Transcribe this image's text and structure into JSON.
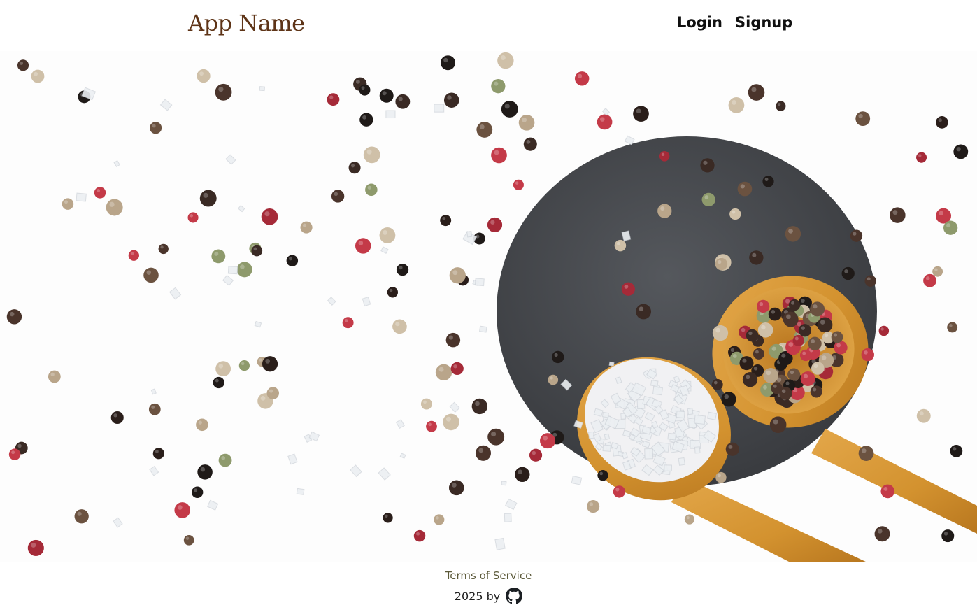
{
  "header": {
    "app_name": "App Name",
    "nav": {
      "login_label": "Login",
      "signup_label": "Signup"
    }
  },
  "hero": {
    "image_icon": "spices-on-slate-photo"
  },
  "footer": {
    "terms_label": "Terms of Service",
    "credit_text": "2025 by",
    "credit_icon": "github-icon"
  },
  "colors": {
    "logo": "#5e3417",
    "nav_text": "#111111",
    "footer_link": "#5c5a3a",
    "slate": "#45474b",
    "spoon_wood": "#d79a3a"
  }
}
